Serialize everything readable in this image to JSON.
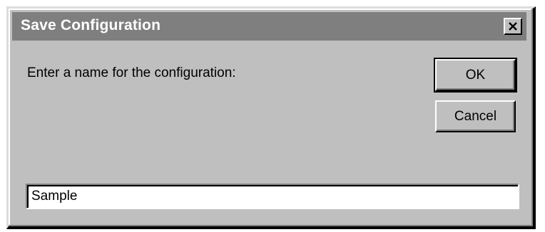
{
  "window": {
    "title": "Save Configuration",
    "close_icon": "close-icon"
  },
  "dialog": {
    "prompt": "Enter a name for the configuration:",
    "ok_label": "OK",
    "cancel_label": "Cancel",
    "name_value": "Sample"
  },
  "colors": {
    "face": "#bfbfbf",
    "titlebar": "#7f7f7f",
    "title_text": "#ffffff"
  }
}
